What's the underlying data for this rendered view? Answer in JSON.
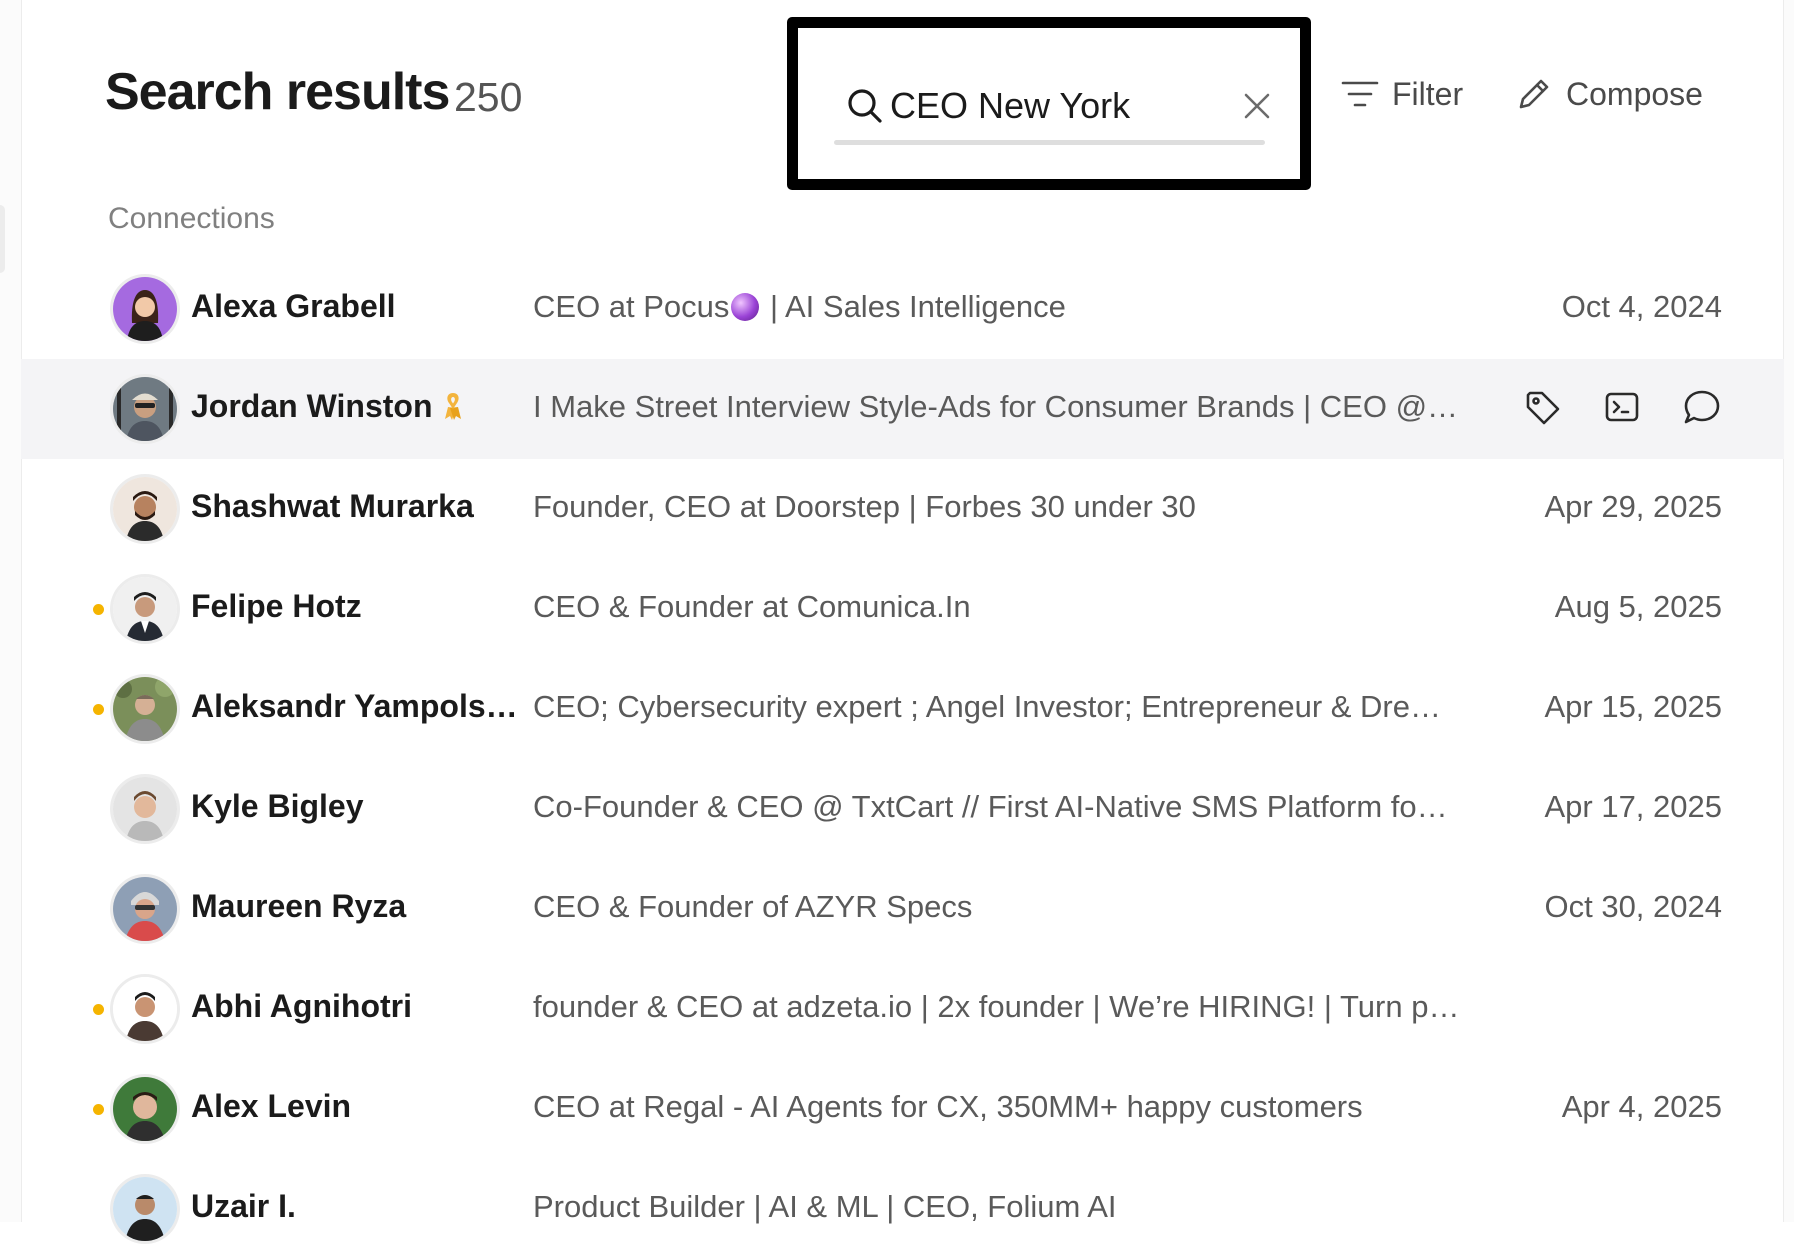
{
  "header": {
    "title": "Search results",
    "count": "250",
    "search": {
      "value": "CEO New York"
    },
    "filter_label": "Filter",
    "compose_label": "Compose"
  },
  "section_label": "Connections",
  "contacts": [
    {
      "name": "Alexa Grabell",
      "headline_pre": "CEO at Pocus",
      "headline_post": " | AI Sales Intelligence",
      "date": "Oct 4, 2024"
    },
    {
      "name": "Jordan Winston",
      "headline": "I Make Street Interview Style-Ads for Consumer Brands | CEO @…"
    },
    {
      "name": "Shashwat Murarka",
      "headline": "Founder, CEO at Doorstep | Forbes 30 under 30",
      "date": "Apr 29, 2025"
    },
    {
      "name": "Felipe Hotz",
      "headline": "CEO & Founder at Comunica.In",
      "date": "Aug 5, 2025"
    },
    {
      "name": "Aleksandr Yampols…",
      "headline": "CEO; Cybersecurity expert ; Angel Investor; Entrepreneur & Dre…",
      "date": "Apr 15, 2025"
    },
    {
      "name": "Kyle Bigley",
      "headline": "Co-Founder & CEO @ TxtCart // First AI-Native SMS Platform fo…",
      "date": "Apr 17, 2025"
    },
    {
      "name": "Maureen Ryza",
      "headline": "CEO & Founder of AZYR Specs",
      "date": "Oct 30, 2024"
    },
    {
      "name": "Abhi Agnihotri",
      "headline": "founder & CEO at adzeta.io | 2x founder | We’re HIRING! | Turn p…"
    },
    {
      "name": "Alex Levin",
      "headline": "CEO at Regal - AI Agents for CX, 350MM+ happy customers",
      "date": "Apr 4, 2025"
    },
    {
      "name": "Uzair I.",
      "headline": "Product Builder | AI & ML | CEO, Folium AI"
    }
  ]
}
